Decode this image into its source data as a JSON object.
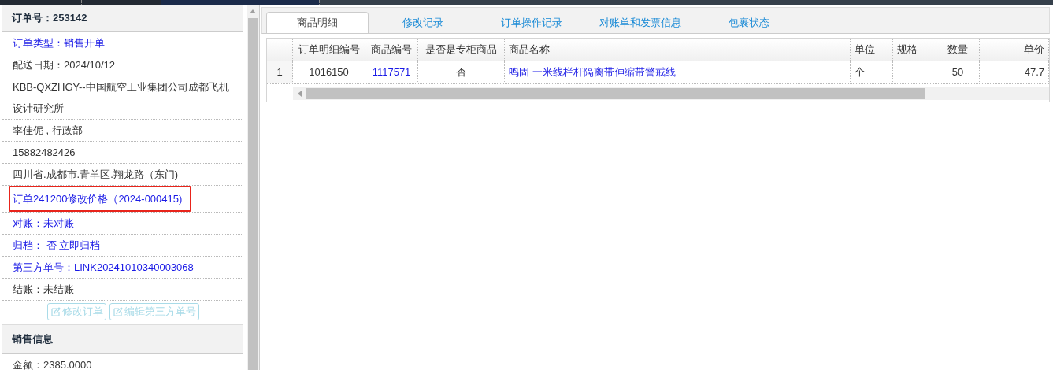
{
  "order": {
    "title": "订单号：253142",
    "fields": [
      {
        "text": "订单类型：销售开单",
        "kind": "link",
        "highlighted": false
      },
      {
        "text": "配送日期：2024/10/12",
        "kind": "text",
        "highlighted": false
      },
      {
        "text": "KBB-QXZHGY--中国航空工业集团公司成都飞机设计研究所",
        "kind": "text",
        "highlighted": false
      },
      {
        "text": "李佳伲 , 行政部",
        "kind": "text",
        "highlighted": false
      },
      {
        "text": "15882482426",
        "kind": "text",
        "highlighted": false
      },
      {
        "text": "四川省.成都市.青羊区.翔龙路（东门)",
        "kind": "text",
        "highlighted": false
      },
      {
        "text": "订单241200修改价格（2024-000415)",
        "kind": "link",
        "highlighted": true
      },
      {
        "text": "对账：未对账",
        "kind": "link",
        "highlighted": false
      },
      {
        "text": "归档： 否 立即归档",
        "kind": "link",
        "highlighted": false
      },
      {
        "text": "第三方单号：LINK20241010340003068",
        "kind": "link",
        "highlighted": false
      },
      {
        "text": "结账：未结账",
        "kind": "text",
        "highlighted": false
      }
    ],
    "buttons": [
      {
        "label": "修改订单",
        "disabled": true
      },
      {
        "label": "编辑第三方单号",
        "disabled": true
      }
    ]
  },
  "sales": {
    "title": "销售信息",
    "fields": [
      "金额：2385.0000"
    ]
  },
  "tabs": [
    {
      "label": "商品明细",
      "selected": true
    },
    {
      "label": "修改记录",
      "selected": false
    },
    {
      "label": "订单操作记录",
      "selected": false
    },
    {
      "label": "对账单和发票信息",
      "selected": false
    },
    {
      "label": "包裹状态",
      "selected": false
    }
  ],
  "table": {
    "columns": [
      "订单明细编号",
      "商品编号",
      "是否是专柜商品",
      "商品名称",
      "单位",
      "规格",
      "数量",
      "单价"
    ],
    "rows": [
      {
        "index": "1",
        "cells": [
          {
            "text": "1016150",
            "link": false
          },
          {
            "text": "1117571",
            "link": true
          },
          {
            "text": "否",
            "link": false
          },
          {
            "text": "鸣固 一米线栏杆隔离带伸缩带警戒线",
            "link": true
          },
          {
            "text": "个",
            "link": false
          },
          null,
          {
            "text": "50",
            "link": false
          },
          {
            "text": "47.7",
            "link": false
          }
        ]
      }
    ]
  }
}
